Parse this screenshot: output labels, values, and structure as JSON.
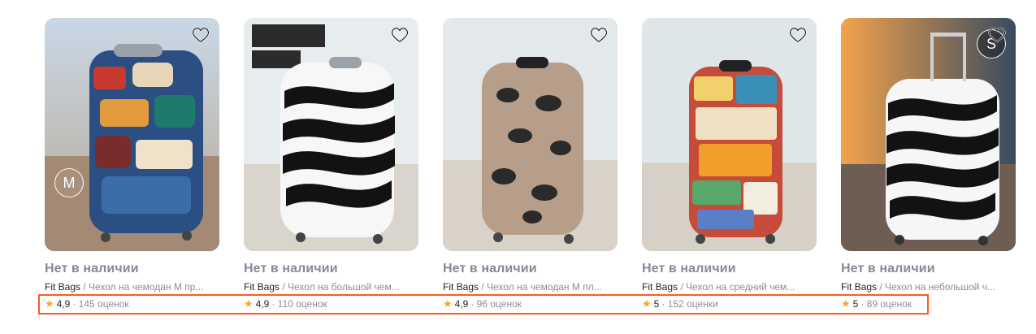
{
  "products": [
    {
      "status": "Нет в наличии",
      "brand": "Fit Bags",
      "title": " / Чехол на чемодан М пр...",
      "rating": "4,9",
      "reviews": "· 145 оценок",
      "badge": "M",
      "badge_position": "bottom-left",
      "image_name": "sticker-suitcase"
    },
    {
      "status": "Нет в наличии",
      "brand": "Fit Bags",
      "title": " / Чехол на большой чем...",
      "rating": "4,9",
      "reviews": "· 110 оценок",
      "image_name": "zebra-suitcase"
    },
    {
      "status": "Нет в наличии",
      "brand": "Fit Bags",
      "title": " / Чехол на чемодан М пл...",
      "rating": "4,9",
      "reviews": "· 96 оценок",
      "image_name": "leopard-suitcase"
    },
    {
      "status": "Нет в наличии",
      "brand": "Fit Bags",
      "title": " / Чехол на средний чем...",
      "rating": "5",
      "reviews": "· 152 оценки",
      "image_name": "ticket-suitcase"
    },
    {
      "status": "Нет в наличии",
      "brand": "Fit Bags",
      "title": " / Чехол на небольшой ч...",
      "rating": "5",
      "reviews": "· 89 оценок",
      "badge": "S",
      "badge_position": "top-right",
      "image_name": "zebra-suitcase"
    }
  ],
  "colors": {
    "star": "#f6a623",
    "highlight": "#ff5a1f",
    "muted_text": "#8d8a99",
    "dark_text": "#242424"
  }
}
